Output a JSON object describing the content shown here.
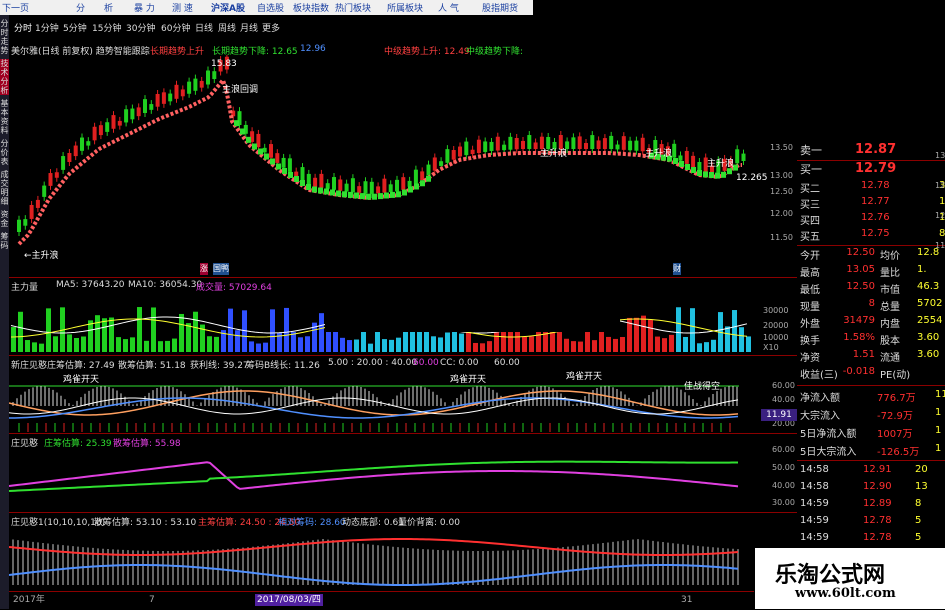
{
  "topbar": {
    "items": [
      "下一页",
      "分",
      "析",
      "暴 力",
      "测 速",
      "沪深A股",
      "自选股",
      "板块指数",
      "热门板块",
      "所属板块",
      "人 气",
      "股指期货"
    ]
  },
  "sidebar": {
    "labels": [
      "分时走势",
      "技术分析",
      "基本资料",
      "分价表",
      "成交明细",
      "资金",
      "筹码"
    ]
  },
  "periods": [
    "分时",
    "1分钟",
    "5分钟",
    "15分钟",
    "30分钟",
    "60分钟",
    "日线",
    "周线",
    "月线",
    "更多"
  ],
  "main": {
    "title": "美尔雅(日线 前复权) 趋势智能跟踪",
    "long_up": "长期趋势上升",
    "long_down": "长期趋势下降: 12.65",
    "long_down_val": "12.96",
    "mid_up": "中级趋势上升: 12.49",
    "mid_down": "中级趋势下降:",
    "price_labels": [
      "15.83",
      "12.265"
    ],
    "annotations": [
      "主浪回调",
      "主升浪",
      "主升浪",
      "主升浪",
      "←主升浪"
    ],
    "markers": [
      "涨",
      "国鸭",
      "财"
    ],
    "price_axis": [
      "13.50",
      "13.00",
      "12.50",
      "12.00",
      "11.50"
    ]
  },
  "volume": {
    "label": "主力量",
    "ma5": "MA5: 37643.20",
    "ma10": "MA10: 36054.30",
    "vol": "成交量: 57029.64",
    "axis": [
      "30000",
      "20000",
      "10000",
      "X10"
    ]
  },
  "indicator1": {
    "label": "新庄见憨",
    "a": "庄筹估算: 27.49",
    "b": "散筹估算: 51.18",
    "c": "获利线: 39.27",
    "d": "筹码B线长: 11.26",
    "e": "5.00 : 20.00 : 40.00",
    "f": "60.00",
    "g": "CC: 0.00",
    "h": "60.00",
    "annotations": [
      "鸡雀开天",
      "鸡雀开天",
      "鸡雀开天",
      "佳战得空"
    ],
    "axis": [
      "60.00",
      "40.00",
      "20.00"
    ],
    "current": "11.91"
  },
  "indicator2": {
    "label": "庄见憨",
    "a": "庄筹估算: 25.39",
    "b": "散筹估算: 55.98",
    "axis": [
      "60.00",
      "50.00",
      "40.00",
      "30.00"
    ]
  },
  "indicator3": {
    "label": "庄见憨1(10,10,10,10)",
    "a": "散筹估算: 53.10 : 53.10",
    "b": "主筹估算: 24.50 : 24.50",
    "c": "相对筹码: 28.60",
    "d": "动态底部: 0.61",
    "e": "量价背离: 0.00"
  },
  "dates": {
    "left": "2017年",
    "mid": "7",
    "selected": "2017/08/03/四",
    "right": "31"
  },
  "quote": {
    "sell1": {
      "label": "卖一",
      "price": "12.87"
    },
    "buy1": {
      "label": "买一",
      "price": "12.79"
    },
    "buys": [
      {
        "label": "买二",
        "price": "12.78",
        "vol": "3"
      },
      {
        "label": "买三",
        "price": "12.77",
        "vol": "1"
      },
      {
        "label": "买四",
        "price": "12.76",
        "vol": "1"
      },
      {
        "label": "买五",
        "price": "12.75",
        "vol": "8"
      }
    ],
    "stats": [
      {
        "l": "今开",
        "v": "12.50",
        "l2": "均价",
        "v2": "12.8"
      },
      {
        "l": "最高",
        "v": "13.05",
        "l2": "量比",
        "v2": "1."
      },
      {
        "l": "最低",
        "v": "12.50",
        "l2": "市值",
        "v2": "46.3"
      },
      {
        "l": "现量",
        "v": "8",
        "l2": "总量",
        "v2": "5702"
      },
      {
        "l": "外盘",
        "v": "31479",
        "l2": "内盘",
        "v2": "2554"
      },
      {
        "l": "换手",
        "v": "1.58%",
        "l2": "股本",
        "v2": "3.60"
      },
      {
        "l": "净资",
        "v": "1.51",
        "l2": "流通",
        "v2": "3.60"
      },
      {
        "l": "收益(三)",
        "v": "-0.018",
        "l2": "PE(动)",
        "v2": ""
      }
    ],
    "flows": [
      {
        "l": "净流入额",
        "v": "776.7万",
        "v2": "11"
      },
      {
        "l": "大宗流入",
        "v": "-72.9万",
        "v2": "1"
      },
      {
        "l": "5日净流入额",
        "v": "1007万",
        "v2": "1"
      },
      {
        "l": "5日大宗流入",
        "v": "-126.5万",
        "v2": "1"
      }
    ],
    "ticks": [
      {
        "t": "14:58",
        "p": "12.91",
        "v": "20"
      },
      {
        "t": "14:58",
        "p": "12.90",
        "v": "13"
      },
      {
        "t": "14:59",
        "p": "12.89",
        "v": "8"
      },
      {
        "t": "14:59",
        "p": "12.78",
        "v": "5"
      },
      {
        "t": "14:59",
        "p": "12.78",
        "v": "5"
      }
    ],
    "side_axis": [
      "13.00",
      "12.50",
      "12.00",
      "11.50"
    ]
  },
  "logo": {
    "title": "乐淘公式网",
    "url": "www.60lt.com"
  },
  "colors": {
    "up": "#ff3030",
    "down": "#20e020",
    "yellow": "#ffff30",
    "magenta": "#e040e0",
    "blue": "#5090ff"
  }
}
